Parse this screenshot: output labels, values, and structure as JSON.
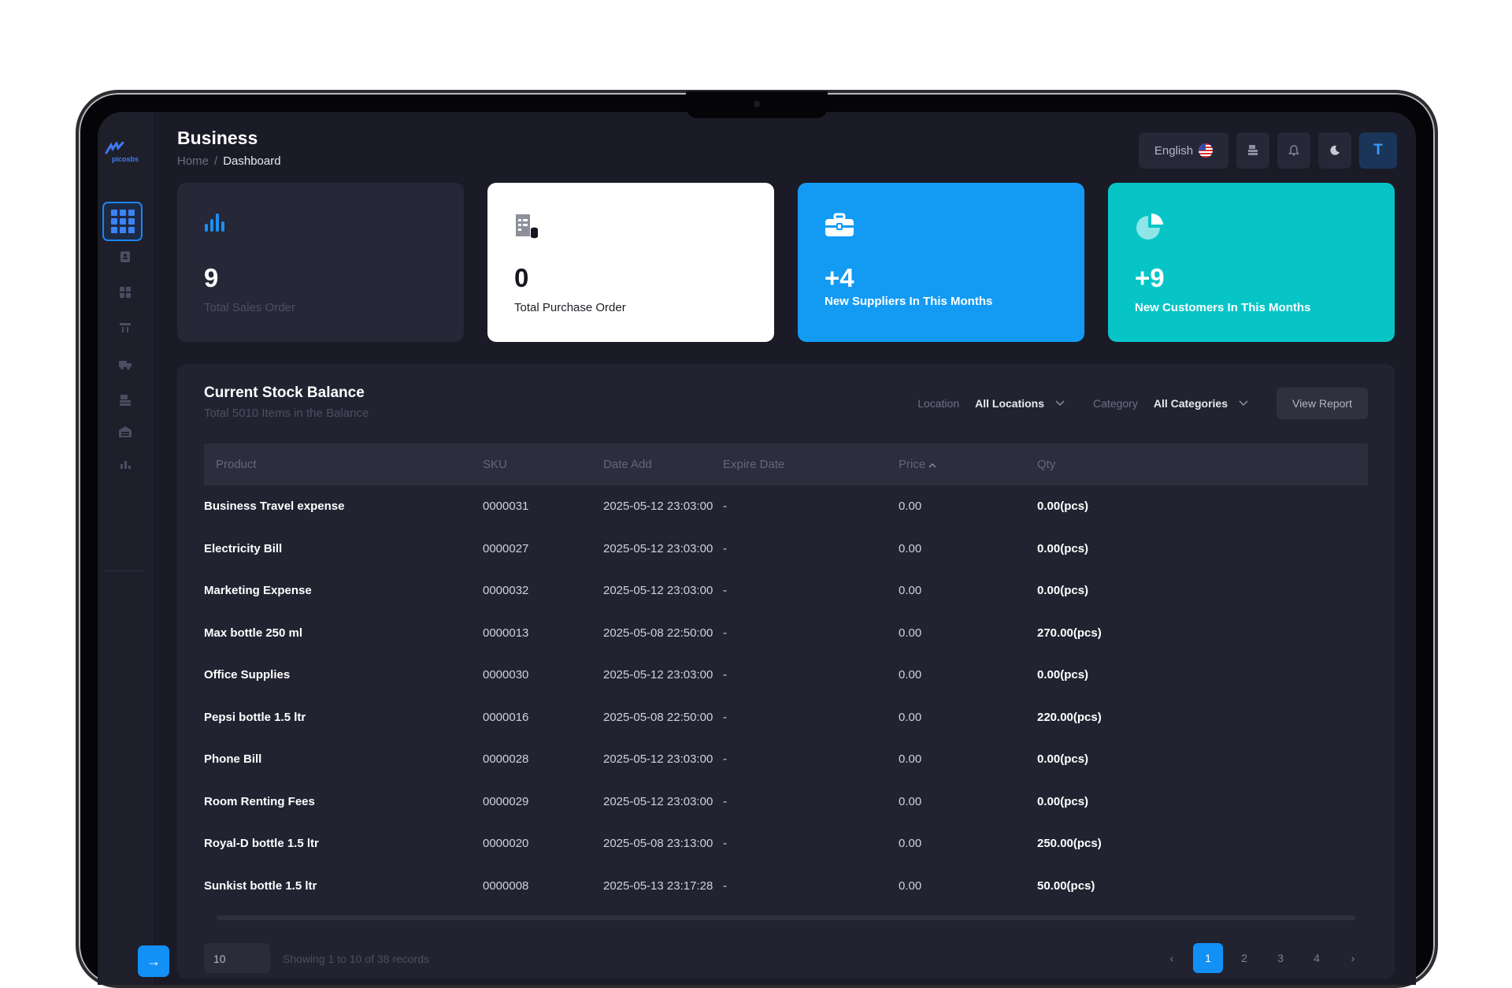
{
  "app": {
    "logo_text": "picosbs"
  },
  "header": {
    "title": "Business",
    "breadcrumb": {
      "home": "Home",
      "separator": "/",
      "current": "Dashboard"
    },
    "language": "English",
    "avatar_initial": "T"
  },
  "stats": [
    {
      "value": "9",
      "label": "Total Sales Order",
      "icon": "bar-chart-icon"
    },
    {
      "value": "0",
      "label": "Total Purchase Order",
      "icon": "receipt-icon"
    },
    {
      "value": "+4",
      "label": "New Suppliers In This Months",
      "icon": "briefcase-icon"
    },
    {
      "value": "+9",
      "label": "New Customers In This Months",
      "icon": "pie-chart-icon"
    }
  ],
  "stock": {
    "title": "Current Stock Balance",
    "subtitle": "Total 5010 Items in the Balance",
    "location_label": "Location",
    "location_value": "All Locations",
    "category_label": "Category",
    "category_value": "All Categories",
    "view_report": "View Report",
    "columns": [
      "Product",
      "SKU",
      "Date Add",
      "Expire Date",
      "Price",
      "Qty"
    ],
    "sort_column": "Price",
    "rows": [
      {
        "product": "Business Travel expense",
        "sku": "0000031",
        "date": "2025-05-12 23:03:00",
        "expire": "-",
        "price": "0.00",
        "qty": "0.00(pcs)"
      },
      {
        "product": "Electricity Bill",
        "sku": "0000027",
        "date": "2025-05-12 23:03:00",
        "expire": "-",
        "price": "0.00",
        "qty": "0.00(pcs)"
      },
      {
        "product": "Marketing Expense",
        "sku": "0000032",
        "date": "2025-05-12 23:03:00",
        "expire": "-",
        "price": "0.00",
        "qty": "0.00(pcs)"
      },
      {
        "product": "Max bottle 250 ml",
        "sku": "0000013",
        "date": "2025-05-08 22:50:00",
        "expire": "-",
        "price": "0.00",
        "qty": "270.00(pcs)"
      },
      {
        "product": "Office Supplies",
        "sku": "0000030",
        "date": "2025-05-12 23:03:00",
        "expire": "-",
        "price": "0.00",
        "qty": "0.00(pcs)"
      },
      {
        "product": "Pepsi bottle 1.5 ltr",
        "sku": "0000016",
        "date": "2025-05-08 22:50:00",
        "expire": "-",
        "price": "0.00",
        "qty": "220.00(pcs)"
      },
      {
        "product": "Phone Bill",
        "sku": "0000028",
        "date": "2025-05-12 23:03:00",
        "expire": "-",
        "price": "0.00",
        "qty": "0.00(pcs)"
      },
      {
        "product": "Room Renting Fees",
        "sku": "0000029",
        "date": "2025-05-12 23:03:00",
        "expire": "-",
        "price": "0.00",
        "qty": "0.00(pcs)"
      },
      {
        "product": "Royal-D bottle 1.5 ltr",
        "sku": "0000020",
        "date": "2025-05-08 23:13:00",
        "expire": "-",
        "price": "0.00",
        "qty": "250.00(pcs)"
      },
      {
        "product": "Sunkist bottle 1.5 ltr",
        "sku": "0000008",
        "date": "2025-05-13 23:17:28",
        "expire": "-",
        "price": "0.00",
        "qty": "50.00(pcs)"
      }
    ],
    "page_size": "10",
    "records_info": "Showing 1 to 10 of 38 records",
    "pages": [
      "1",
      "2",
      "3",
      "4"
    ],
    "current_page": "1"
  },
  "colors": {
    "accent": "#1390f5",
    "teal": "#07c5c7",
    "bg": "#1a1b26"
  }
}
